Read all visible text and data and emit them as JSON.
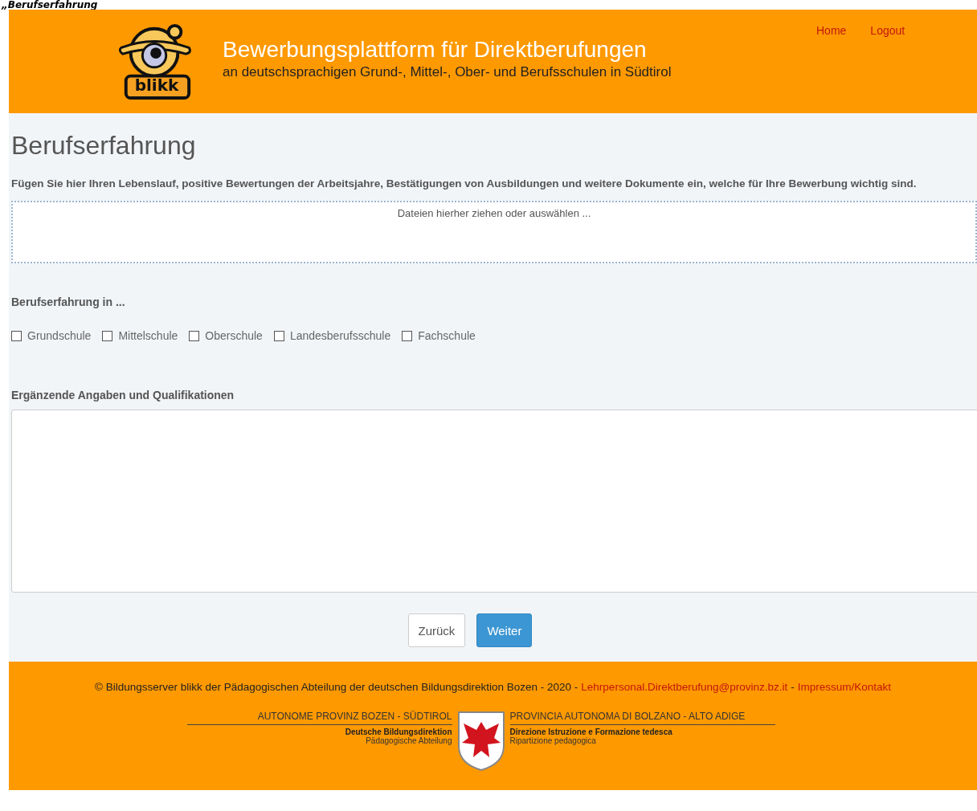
{
  "caption": "„Berufserfahrung",
  "header": {
    "title": "Bewerbungsplattform für Direktberufungen",
    "subtitle": "an deutschsprachigen Grund-, Mittel-, Ober- und Berufsschulen in Südtirol",
    "logo_text": "blikk",
    "nav": [
      "Home",
      "Logout"
    ]
  },
  "page": {
    "heading": "Berufserfahrung",
    "intro": "Fügen Sie hier Ihren Lebenslauf, positive Bewertungen der Arbeitsjahre, Bestätigungen von Ausbildungen und weitere Dokumente ein, welche für Ihre Bewerbung wichtig sind.",
    "dropzone": "Dateien hierher ziehen oder auswählen ...",
    "experience_label": "Berufserfahrung in ...",
    "schools": [
      {
        "label": "Grundschule",
        "checked": false
      },
      {
        "label": "Mittelschule",
        "checked": false
      },
      {
        "label": "Oberschule",
        "checked": false
      },
      {
        "label": "Landesberufsschule",
        "checked": false
      },
      {
        "label": "Fachschule",
        "checked": false
      }
    ],
    "notes_label": "Ergänzende Angaben und Qualifikationen",
    "buttons": [
      {
        "label": "Zurück",
        "kind": "default"
      },
      {
        "label": "Weiter",
        "kind": "primary"
      }
    ]
  },
  "footer": {
    "copyright": "© Bildungsserver blikk der Pädagogischen Abteilung der deutschen Bildungsdirektion Bozen - 2020 -",
    "email": "Lehrpersonal.Direktberufung@provinz.bz.it",
    "separator": "-",
    "impressum": "Impressum/Kontakt",
    "left": {
      "title": "AUTONOME PROVINZ BOZEN - SÜDTIROL",
      "line1": "Deutsche Bildungsdirektion",
      "line2": "Pädagogische Abteilung"
    },
    "right": {
      "title": "PROVINCIA AUTONOMA DI BOLZANO - ALTO ADIGE",
      "line1": "Direzione Istruzione e Formazione tedesca",
      "line2": "Ripartizione pedagogica"
    }
  }
}
